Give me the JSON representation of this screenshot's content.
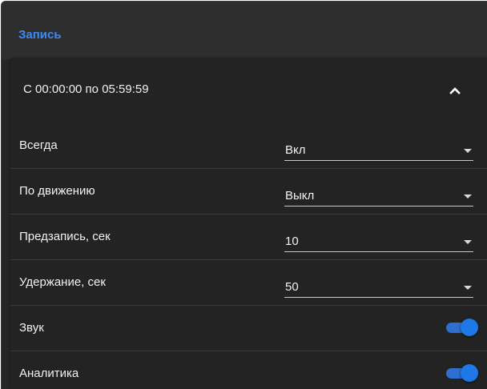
{
  "section": {
    "title": "Запись"
  },
  "schedule": {
    "range_label": "С 00:00:00 по 05:59:59",
    "expanded": true,
    "collapse_icon": "chevron-up-icon"
  },
  "settings": {
    "always": {
      "label": "Всегда",
      "value": "Вкл"
    },
    "motion": {
      "label": "По движению",
      "value": "Выкл"
    },
    "prerecord": {
      "label": "Предзапись, сек",
      "value": "10"
    },
    "hold": {
      "label": "Удержание, сек",
      "value": "50"
    },
    "sound": {
      "label": "Звук",
      "enabled": true
    },
    "analytics": {
      "label": "Аналитика",
      "enabled": true
    }
  },
  "colors": {
    "accent": "#3d8af7",
    "toggle_on": "#1e78e6",
    "background": "#262626"
  }
}
